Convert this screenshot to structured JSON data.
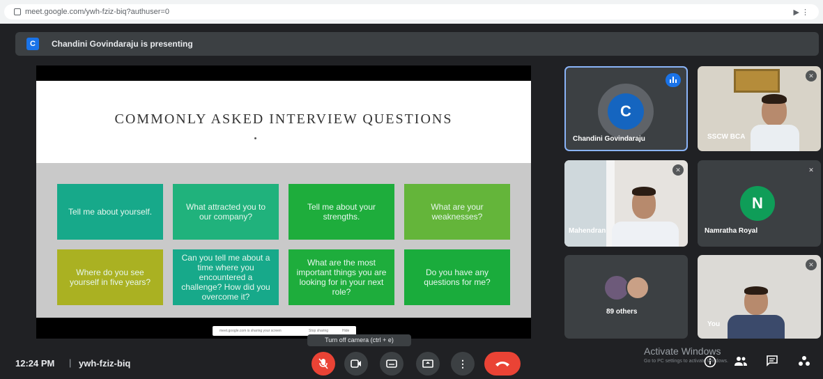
{
  "browser": {
    "url": "meet.google.com/ywh-fziz-biq?authuser=0",
    "extension_glyph": "▶ ⋮"
  },
  "presenting": {
    "avatar_letter": "C",
    "text": "Chandini Govindaraju is presenting"
  },
  "slide": {
    "title": "COMMONLY ASKED INTERVIEW QUESTIONS",
    "cards": [
      {
        "text": "Tell me about yourself.",
        "color": "#17a98a"
      },
      {
        "text": "What attracted you to our company?",
        "color": "#20b27c"
      },
      {
        "text": "Tell me about your strengths.",
        "color": "#1ead3c"
      },
      {
        "text": "What are your weaknesses?",
        "color": "#64b53a"
      },
      {
        "text": "Where do you see yourself in five years?",
        "color": "#aab122"
      },
      {
        "text": "Can you tell me about a time where you encountered a challenge? How did you overcome it?",
        "color": "#17a98a"
      },
      {
        "text": "What are the most important things you are looking for in your next role?",
        "color": "#1ead3c"
      },
      {
        "text": "Do you have any questions for me?",
        "color": "#1aac3c"
      }
    ],
    "share_bar": {
      "text": "meet.google.com is sharing your screen",
      "stop": "Stop sharing",
      "hide": "Hide"
    }
  },
  "participants": [
    {
      "name": "Chandini Govindaraju",
      "avatar_letter": "C",
      "avatar_color": "#1565c0",
      "speaking": true
    },
    {
      "name": "SSCW BCA",
      "camera": true
    },
    {
      "name": "Mahendran",
      "camera": true
    },
    {
      "name": "Namratha Royal",
      "avatar_letter": "N",
      "avatar_color": "#0f9d58"
    },
    {
      "name": "89 others"
    },
    {
      "name": "You",
      "camera": true
    }
  ],
  "tooltip": "Turn off camera (ctrl + e)",
  "bottom": {
    "time": "12:24 PM",
    "separator": "|",
    "meeting_code": "ywh-fziz-biq"
  },
  "activate_windows": {
    "title": "Activate Windows",
    "subtitle": "Go to PC settings to activate Windows."
  },
  "colors": {
    "end_call": "#ea4335",
    "mic_off": "#ea4335",
    "accent_blue": "#1a73e8"
  }
}
